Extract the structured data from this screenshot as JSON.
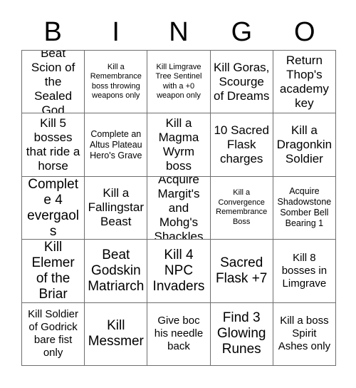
{
  "card": {
    "title": "BINGO",
    "header_letters": [
      "B",
      "I",
      "N",
      "G",
      "O"
    ],
    "columns": 5,
    "rows": 5,
    "colors": {
      "background": "#ffffff",
      "text": "#000000",
      "grid_line": "#6e6e6e"
    },
    "cells": [
      {
        "text": "Beat Scion of the Sealed God",
        "size": "lg"
      },
      {
        "text": "Kill a Remembrance boss throwing weapons only",
        "size": "xs"
      },
      {
        "text": "Kill Limgrave Tree Sentinel with a +0 weapon only",
        "size": "xs"
      },
      {
        "text": "Kill Goras, Scourge of Dreams",
        "size": "lg"
      },
      {
        "text": "Return Thop's academy key",
        "size": "lg"
      },
      {
        "text": "Kill 5 bosses that ride a horse",
        "size": "lg"
      },
      {
        "text": "Complete an Altus Plateau Hero's Grave",
        "size": "sm"
      },
      {
        "text": "Kill a Magma Wyrm boss",
        "size": "lg"
      },
      {
        "text": "10 Sacred Flask charges",
        "size": "lg"
      },
      {
        "text": "Kill a Dragonkin Soldier",
        "size": "lg"
      },
      {
        "text": "Complete 4 evergaols",
        "size": "xl"
      },
      {
        "text": "Kill a Fallingstar Beast",
        "size": "lg"
      },
      {
        "text": "Acquire Margit's and Mohg's Shackles",
        "size": "lg"
      },
      {
        "text": "Kill a Convergence Remembrance Boss",
        "size": "xs"
      },
      {
        "text": "Acquire Shadowstone Somber Bell Bearing 1",
        "size": "sm"
      },
      {
        "text": "Kill Elemer of the Briar",
        "size": "xl"
      },
      {
        "text": "Beat Godskin Matriarch",
        "size": "xl"
      },
      {
        "text": "Kill 4 NPC Invaders",
        "size": "xl"
      },
      {
        "text": "Sacred Flask +7",
        "size": "xl"
      },
      {
        "text": "Kill 8 bosses in Limgrave",
        "size": "md"
      },
      {
        "text": "Kill Soldier of Godrick bare fist only",
        "size": "md"
      },
      {
        "text": "Kill Messmer",
        "size": "xl"
      },
      {
        "text": "Give boc his needle back",
        "size": "md"
      },
      {
        "text": "Find 3 Glowing Runes",
        "size": "xl"
      },
      {
        "text": "Kill a boss Spirit Ashes only",
        "size": "md"
      }
    ]
  }
}
